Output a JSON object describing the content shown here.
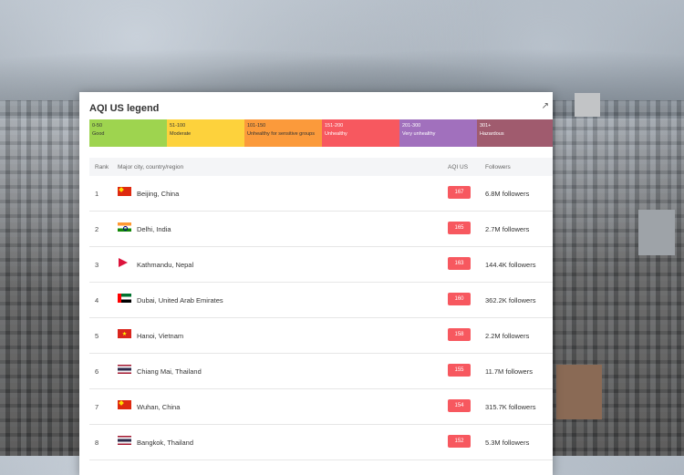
{
  "legend": {
    "title": "AQI US legend",
    "segments": [
      {
        "range": "0-50",
        "label": "Good",
        "color": "#9ed44f"
      },
      {
        "range": "51-100",
        "label": "Moderate",
        "color": "#fdd23c"
      },
      {
        "range": "101-150",
        "label": "Unhealthy for sensitive groups",
        "color": "#fb9a3b"
      },
      {
        "range": "151-200",
        "label": "Unhealthy",
        "color": "#f7585f"
      },
      {
        "range": "201-300",
        "label": "Very unhealthy",
        "color": "#a170bd"
      },
      {
        "range": "301+",
        "label": "Hazardous",
        "color": "#a05b6e"
      }
    ]
  },
  "table": {
    "headers": {
      "rank": "Rank",
      "city": "Major city, country/region",
      "aqi": "AQI US",
      "followers": "Followers"
    },
    "rows": [
      {
        "rank": "1",
        "flag": "china-flag-icon",
        "city": "Beijing, China",
        "aqi": "167",
        "followers": "6.8M followers"
      },
      {
        "rank": "2",
        "flag": "india-flag-icon",
        "city": "Delhi, India",
        "aqi": "165",
        "followers": "2.7M followers"
      },
      {
        "rank": "3",
        "flag": "nepal-flag-icon",
        "city": "Kathmandu, Nepal",
        "aqi": "163",
        "followers": "144.4K followers"
      },
      {
        "rank": "4",
        "flag": "uae-flag-icon",
        "city": "Dubai, United Arab Emirates",
        "aqi": "160",
        "followers": "362.2K followers"
      },
      {
        "rank": "5",
        "flag": "vietnam-flag-icon",
        "city": "Hanoi, Vietnam",
        "aqi": "158",
        "followers": "2.2M followers"
      },
      {
        "rank": "6",
        "flag": "thailand-flag-icon",
        "city": "Chiang Mai, Thailand",
        "aqi": "155",
        "followers": "11.7M followers"
      },
      {
        "rank": "7",
        "flag": "china-flag-icon",
        "city": "Wuhan, China",
        "aqi": "154",
        "followers": "315.7K followers"
      },
      {
        "rank": "8",
        "flag": "thailand-flag-icon",
        "city": "Bangkok, Thailand",
        "aqi": "152",
        "followers": "5.3M followers"
      }
    ]
  },
  "colors": {
    "unhealthy_badge": "#f7585f"
  }
}
